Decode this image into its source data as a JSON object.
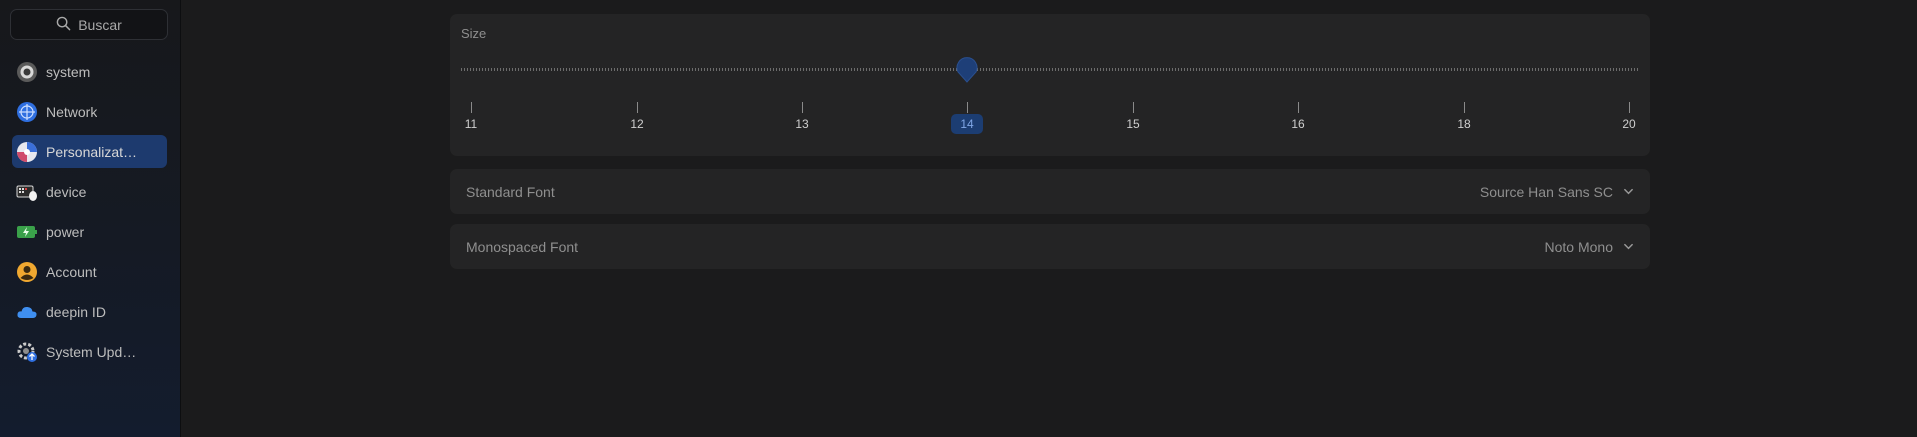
{
  "sidebar": {
    "search_placeholder": "Buscar",
    "items": [
      {
        "label": "system",
        "icon": "system-icon",
        "active": false
      },
      {
        "label": "Network",
        "icon": "network-icon",
        "active": false
      },
      {
        "label": "Personalizat…",
        "icon": "personalization-icon",
        "active": true
      },
      {
        "label": "device",
        "icon": "device-icon",
        "active": false
      },
      {
        "label": "power",
        "icon": "power-icon",
        "active": false
      },
      {
        "label": "Account",
        "icon": "account-icon",
        "active": false
      },
      {
        "label": "deepin ID",
        "icon": "cloud-icon",
        "active": false
      },
      {
        "label": "System Upd…",
        "icon": "system-update-icon",
        "active": false
      }
    ]
  },
  "size_panel": {
    "title": "Size",
    "ticks": [
      "11",
      "12",
      "13",
      "14",
      "15",
      "16",
      "18",
      "20"
    ],
    "selected_value": "14"
  },
  "standard_font": {
    "label": "Standard Font",
    "value": "Source Han Sans SC"
  },
  "monospaced_font": {
    "label": "Monospaced Font",
    "value": "Noto Mono"
  },
  "colors": {
    "accent": "#1d3a6e",
    "panel": "#242425",
    "background": "#1b1b1c"
  }
}
